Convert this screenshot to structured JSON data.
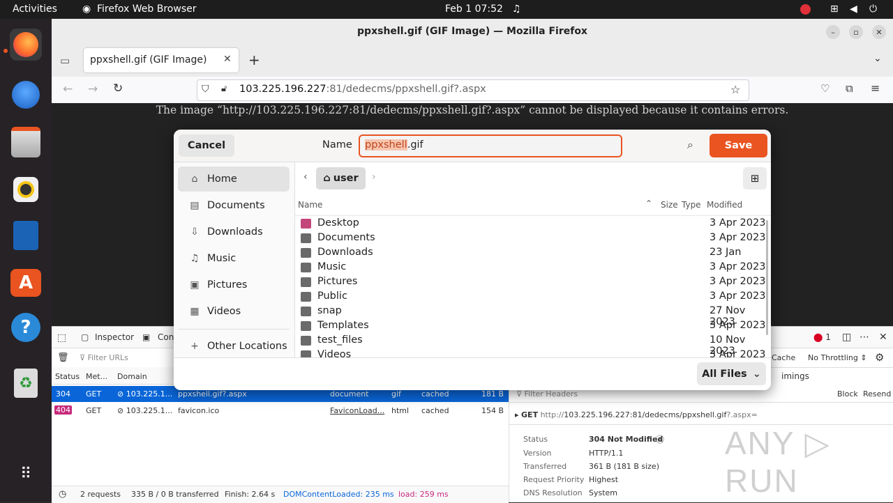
{
  "topbar": {
    "activities": "Activities",
    "app": "Firefox Web Browser",
    "clock": "Feb 1  07:52"
  },
  "window": {
    "title": "ppxshell.gif (GIF Image) — Mozilla Firefox"
  },
  "tab": {
    "label": "ppxshell.gif (GIF Image)"
  },
  "url": {
    "host": "103.225.196.227",
    "rest": ":81/dedecms/ppxshell.gif?.aspx"
  },
  "page": {
    "error": "The image “http://103.225.196.227:81/dedecms/ppxshell.gif?.aspx” cannot be displayed because it contains errors."
  },
  "dialog": {
    "cancel": "Cancel",
    "name_label": "Name",
    "name_selected": "ppxshell",
    "name_ext": ".gif",
    "save": "Save",
    "path": "user",
    "columns": {
      "name": "Name",
      "size": "Size",
      "type": "Type",
      "modified": "Modified"
    },
    "sidebar": [
      {
        "icon": "home-icon",
        "label": "Home"
      },
      {
        "icon": "documents-icon",
        "label": "Documents"
      },
      {
        "icon": "downloads-icon",
        "label": "Downloads"
      },
      {
        "icon": "music-icon",
        "label": "Music"
      },
      {
        "icon": "pictures-icon",
        "label": "Pictures"
      },
      {
        "icon": "videos-icon",
        "label": "Videos"
      },
      {
        "icon": "plus-icon",
        "label": "Other Locations"
      }
    ],
    "files": [
      {
        "name": "Desktop",
        "modified": "3 Apr 2023",
        "color": "#c3467a"
      },
      {
        "name": "Documents",
        "modified": "3 Apr 2023",
        "color": "#6a6a6a"
      },
      {
        "name": "Downloads",
        "modified": "23 Jan",
        "color": "#6a6a6a"
      },
      {
        "name": "Music",
        "modified": "3 Apr 2023",
        "color": "#6a6a6a"
      },
      {
        "name": "Pictures",
        "modified": "3 Apr 2023",
        "color": "#6a6a6a"
      },
      {
        "name": "Public",
        "modified": "3 Apr 2023",
        "color": "#6a6a6a"
      },
      {
        "name": "snap",
        "modified": "27 Nov 2023",
        "color": "#6a6a6a"
      },
      {
        "name": "Templates",
        "modified": "3 Apr 2023",
        "color": "#6a6a6a"
      },
      {
        "name": "test_files",
        "modified": "10 Nov 2023",
        "color": "#6a6a6a"
      },
      {
        "name": "Videos",
        "modified": "3 Apr 2023",
        "color": "#6a6a6a"
      }
    ],
    "filter": "All Files"
  },
  "devtools": {
    "inspector": "Inspector",
    "console": "Cons",
    "filter_urls": "Filter URLs",
    "errors": "1",
    "cache": "Cache",
    "throttling": "No Throttling ⇕",
    "timings": "imings",
    "columns": [
      "Status",
      "Met...",
      "Domain"
    ],
    "requests": [
      {
        "status": "304",
        "method": "GET",
        "domain": "103.225.1...",
        "file": "ppxshell.gif?.aspx",
        "initiator": "document",
        "type": "gif",
        "transferred": "cached",
        "size": "181 B"
      },
      {
        "status": "404",
        "method": "GET",
        "domain": "103.225.1...",
        "file": "favicon.ico",
        "initiator": "FaviconLoad...",
        "type": "html",
        "transferred": "cached",
        "size": "154 B"
      }
    ],
    "footer": {
      "requests": "2 requests",
      "transferred": "335 B / 0 B transferred",
      "finish": "Finish: 2.64 s",
      "dcl": "DOMContentLoaded: 235 ms",
      "load": "load: 259 ms"
    },
    "headers": {
      "filter": "Filter Headers",
      "block": "Block",
      "resend": "Resend",
      "method": "GET",
      "url_prefix": "http://",
      "url_host": "103.225.196.227:81/dedecms/ppxshell.gif",
      "url_suffix": "?.aspx=",
      "rows": [
        {
          "k": "Status",
          "v": "304 Not Modified"
        },
        {
          "k": "Version",
          "v": "HTTP/1.1"
        },
        {
          "k": "Transferred",
          "v": "361 B (181 B size)"
        },
        {
          "k": "Request Priority",
          "v": "Highest"
        },
        {
          "k": "DNS Resolution",
          "v": "System"
        }
      ]
    }
  },
  "watermark": "ANY ▷ RUN",
  "colors": {
    "accent": "#e95420",
    "selection": "#0a66d8"
  }
}
